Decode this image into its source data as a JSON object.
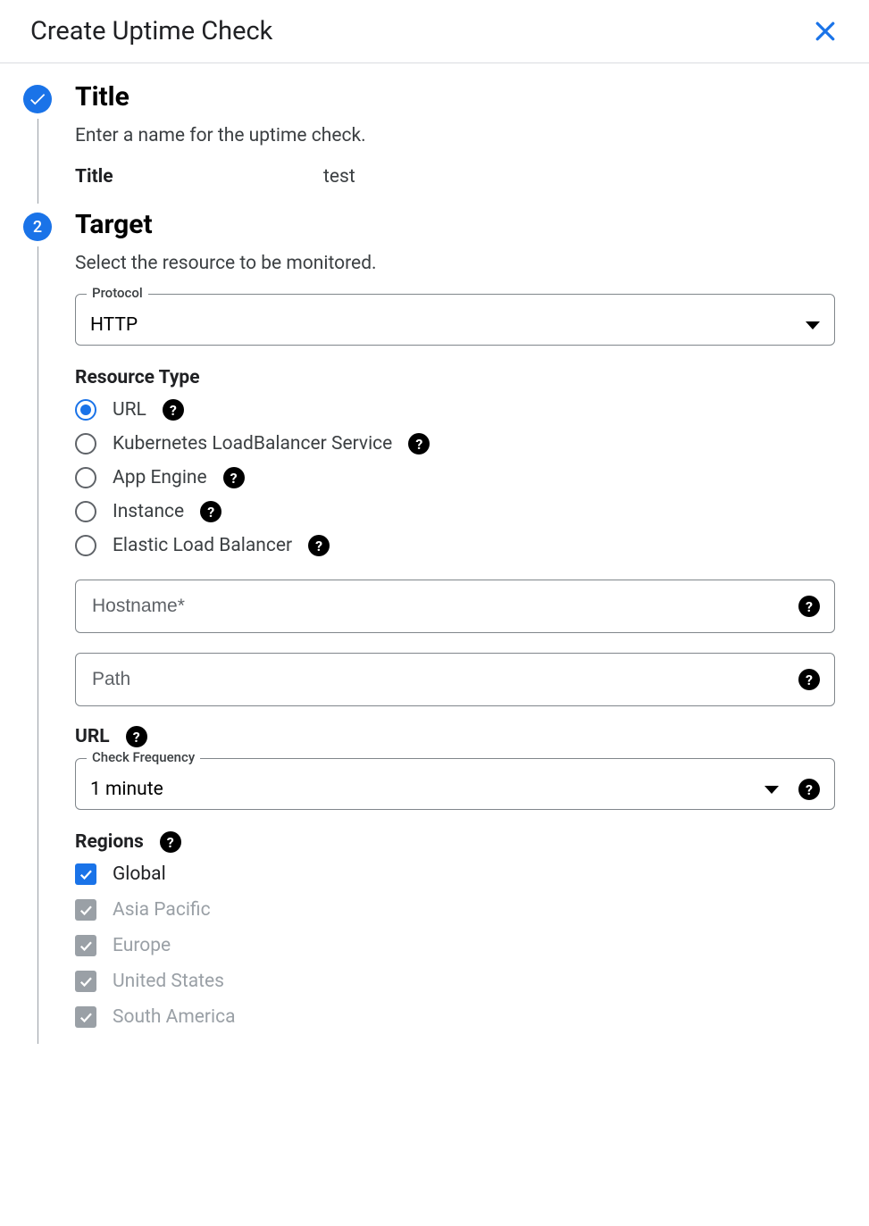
{
  "header": {
    "title": "Create Uptime Check"
  },
  "step1": {
    "heading": "Title",
    "description": "Enter a name for the uptime check.",
    "title_label": "Title",
    "title_value": "test"
  },
  "step2": {
    "number": "2",
    "heading": "Target",
    "description": "Select the resource to be monitored.",
    "protocol_label": "Protocol",
    "protocol_value": "HTTP",
    "resource_type_label": "Resource Type",
    "resource_types": [
      {
        "label": "URL",
        "selected": true
      },
      {
        "label": "Kubernetes LoadBalancer Service",
        "selected": false
      },
      {
        "label": "App Engine",
        "selected": false
      },
      {
        "label": "Instance",
        "selected": false
      },
      {
        "label": "Elastic Load Balancer",
        "selected": false
      }
    ],
    "hostname_placeholder": "Hostname*",
    "path_placeholder": "Path",
    "url_label": "URL",
    "check_frequency_label": "Check Frequency",
    "check_frequency_value": "1 minute",
    "regions_label": "Regions",
    "regions": [
      {
        "label": "Global",
        "checked": true,
        "disabled": false
      },
      {
        "label": "Asia Pacific",
        "checked": true,
        "disabled": true
      },
      {
        "label": "Europe",
        "checked": true,
        "disabled": true
      },
      {
        "label": "United States",
        "checked": true,
        "disabled": true
      },
      {
        "label": "South America",
        "checked": true,
        "disabled": true
      }
    ]
  }
}
